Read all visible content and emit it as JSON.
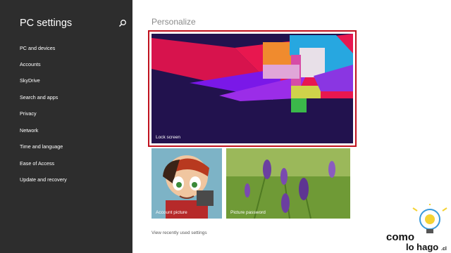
{
  "sidebar": {
    "title": "PC settings",
    "search_icon": "search-icon",
    "items": [
      {
        "label": "PC and devices"
      },
      {
        "label": "Accounts"
      },
      {
        "label": "SkyDrive"
      },
      {
        "label": "Search and apps"
      },
      {
        "label": "Privacy"
      },
      {
        "label": "Network"
      },
      {
        "label": "Time and language"
      },
      {
        "label": "Ease of Access"
      },
      {
        "label": "Update and recovery"
      }
    ]
  },
  "main": {
    "title": "Personalize",
    "tiles": {
      "lock_screen": "Lock screen",
      "account_picture": "Account picture",
      "picture_password": "Picture password"
    },
    "recent_link": "View recently used settings"
  },
  "watermark": {
    "line1": "como",
    "line2": "lo hago",
    "suffix": ".cl"
  },
  "colors": {
    "sidebar_bg": "#2d2d2d",
    "selection_border": "#c0111e",
    "lock_bg": "#22124e",
    "page_title": "#8a8a8a"
  }
}
